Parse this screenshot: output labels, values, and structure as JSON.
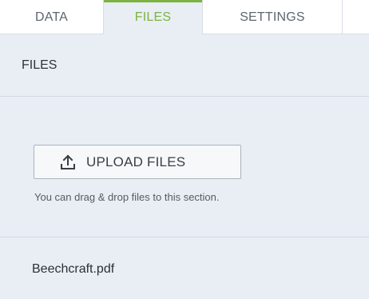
{
  "tabs": [
    {
      "label": "DATA",
      "active": false
    },
    {
      "label": "FILES",
      "active": true
    },
    {
      "label": "SETTINGS",
      "active": false
    }
  ],
  "colors": {
    "accent": "#7cb342",
    "panel_bg": "#e9eef4",
    "tab_bg": "#ffffff",
    "text": "#2f343a"
  },
  "section": {
    "title": "FILES"
  },
  "upload": {
    "button_label": "UPLOAD FILES",
    "icon": "upload-icon",
    "hint": "You can drag & drop files to this section."
  },
  "files": [
    {
      "name": "Beechcraft.pdf"
    }
  ]
}
